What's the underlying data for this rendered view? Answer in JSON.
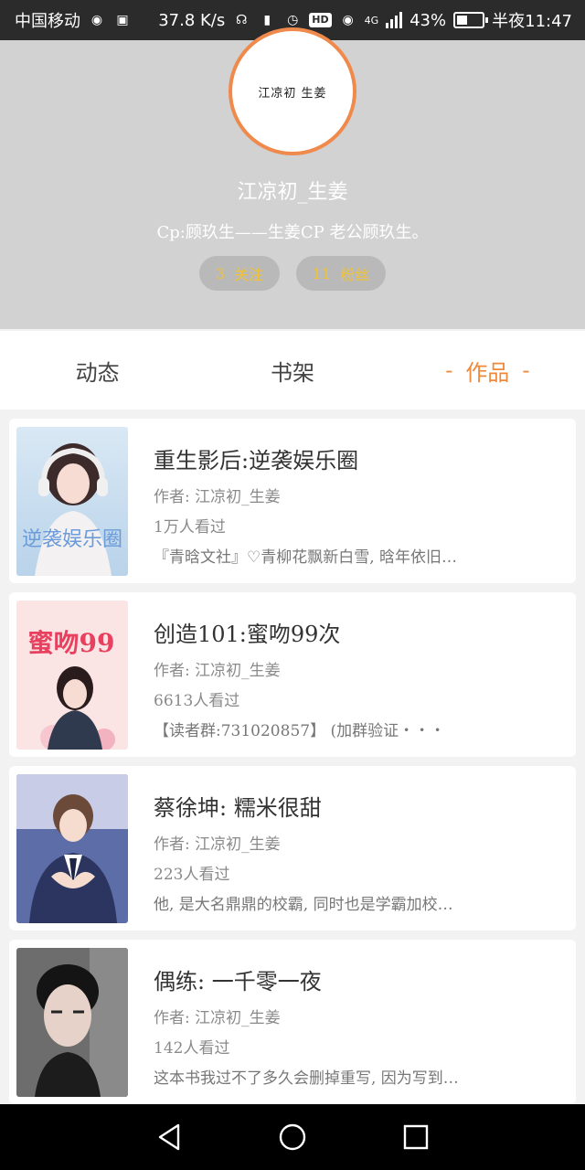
{
  "status_bar": {
    "carrier": "中国移动",
    "speed": "37.8 K/s",
    "hd": "HD",
    "network": "4G",
    "battery_percent": "43%",
    "battery_level": 0.43,
    "time": "半夜11:47"
  },
  "profile": {
    "avatar_text": "江凉初  生姜",
    "username": "江凉初_生姜",
    "bio": "Cp:顾玖生——生姜CP 老公顾玖生。",
    "following_count": "3",
    "following_label": "关注",
    "fans_count": "11",
    "fans_label": "粉丝"
  },
  "tabs": [
    {
      "label": "动态"
    },
    {
      "label": "书架"
    },
    {
      "label": "作品",
      "active": true,
      "dash": "-"
    }
  ],
  "works": [
    {
      "title": "重生影后:逆袭娱乐圈",
      "author": "作者: 江凉初_生姜",
      "views": "1万人看过",
      "desc": "『青晗文社』♡青柳花飘新白雪, 晗年依旧…",
      "cover_text": "逆袭娱乐圈"
    },
    {
      "title": "创造101:蜜吻99次",
      "author": "作者: 江凉初_生姜",
      "views": "6613人看过",
      "desc": "【读者群:731020857】 (加群验证・・・",
      "cover_text": "蜜吻99"
    },
    {
      "title": "蔡徐坤: 糯米很甜",
      "author": "作者: 江凉初_生姜",
      "views": "223人看过",
      "desc": "他, 是大名鼎鼎的校霸, 同时也是学霸加校…",
      "cover_text": ""
    },
    {
      "title": "偶练: 一千零一夜",
      "author": "作者: 江凉初_生姜",
      "views": "142人看过",
      "desc": "这本书我过不了多久会删掉重写, 因为写到…",
      "cover_text": ""
    }
  ],
  "icons": {
    "back": "back-triangle-icon",
    "home": "home-circle-icon",
    "recents": "recents-square-icon"
  },
  "colors": {
    "accent": "#ef8a3c",
    "stat_text": "#f2c230",
    "header_bg": "#d2d2d2"
  }
}
